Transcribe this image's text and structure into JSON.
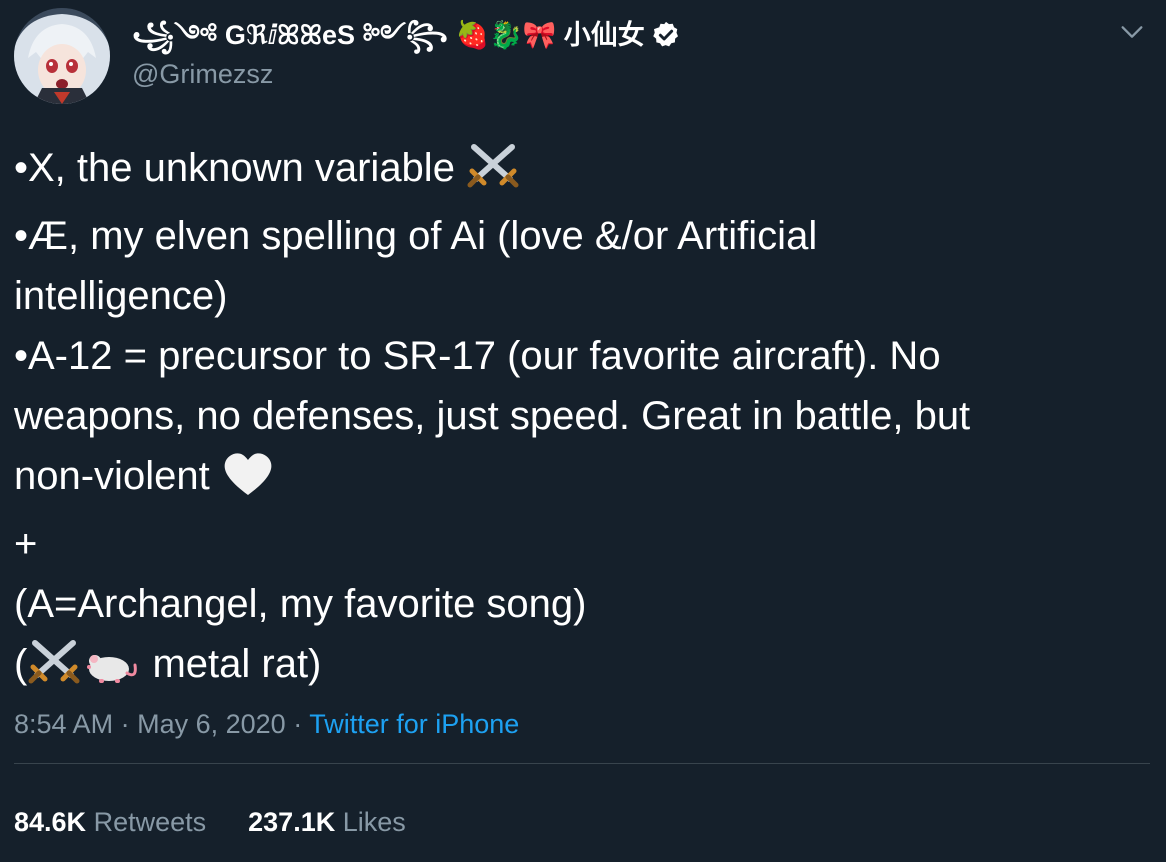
{
  "author": {
    "display_name": "꧁༺ GℜⅈꕤꕤеS ༻꧂ 🍓🐉🎀 小仙女",
    "handle": "@Grimezsz",
    "verified": true,
    "avatar": "anime-avatar"
  },
  "tweet": {
    "lines": [
      "•X, the unknown variable",
      "•Æ, my elven spelling of Ai (love &/or Artificial",
      "intelligence)",
      "•A-12 = precursor to SR-17 (our favorite aircraft).  No",
      "weapons, no defenses, just speed.  Great in battle, but",
      "non-violent",
      "+",
      "(A=Archangel, my favorite song)",
      "(",
      "metal rat)"
    ],
    "emoji": {
      "crossed_swords": "crossed-swords-icon",
      "white_heart": "white-heart-icon",
      "rat": "rat-icon"
    }
  },
  "meta": {
    "time": "8:54 AM",
    "separator": "·",
    "date": "May 6, 2020",
    "source": "Twitter for iPhone"
  },
  "stats": {
    "retweets_count": "84.6K",
    "retweets_label": "Retweets",
    "likes_count": "237.1K",
    "likes_label": "Likes"
  },
  "colors": {
    "background": "#15202b",
    "text": "#ffffff",
    "secondary": "#8899a6",
    "link": "#1da1f2",
    "divider": "#38444d"
  }
}
